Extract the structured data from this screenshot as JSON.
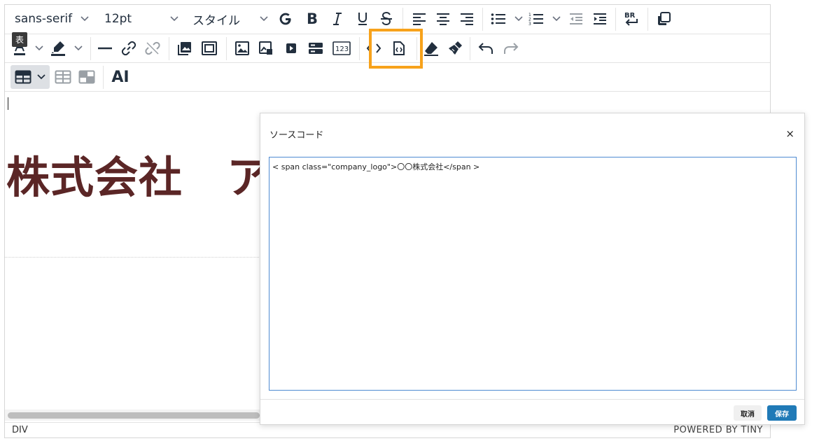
{
  "toolbar": {
    "font_family": "sans-serif",
    "font_size": "12pt",
    "style": "スタイル",
    "bold": "B",
    "tooltip": "表",
    "ai_label": "AI"
  },
  "content": {
    "company_text": "株式会社　ア"
  },
  "statusbar": {
    "path": "DIV",
    "branding": "POWERED BY TINY"
  },
  "dialog": {
    "title": "ソースコード",
    "close": "×",
    "source": "< span class=\"company_logo\">〇〇株式会社</span >",
    "cancel": "取消",
    "save": "保存"
  },
  "colors": {
    "highlight": "#f7a21b",
    "heading_text": "#5b2626",
    "save_button": "#207ab7",
    "textarea_border": "#4e8ad1"
  }
}
